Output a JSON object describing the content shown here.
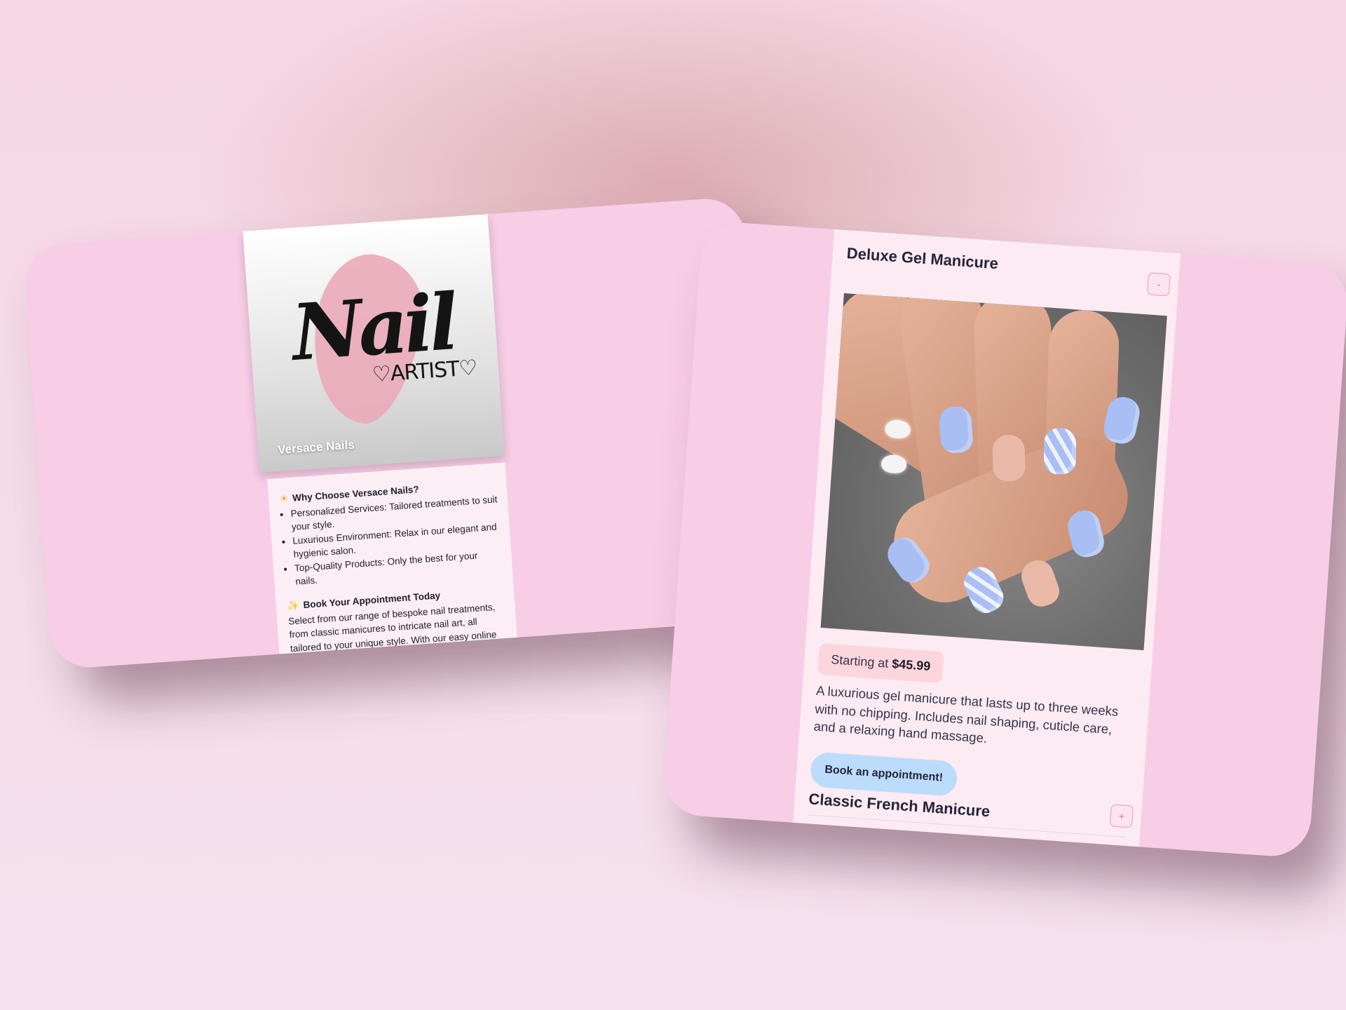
{
  "brand": {
    "logo_text_main": "Nail",
    "logo_text_sub": "♡ARTIST♡",
    "caption": "Versace Nails"
  },
  "info": {
    "why_heading": "Why Choose Versace Nails?",
    "benefits": [
      "Personalized Services: Tailored treatments to suit your style.",
      "Luxurious Environment: Relax in our elegant and hygienic salon.",
      "Top-Quality Products: Only the best for your nails."
    ],
    "book_heading": "Book Your Appointment Today",
    "book_text": "Select from our range of bespoke nail treatments, from classic manicures to intricate nail art, all tailored to your unique style. With our easy online booking system, securing your spot has never been simpler."
  },
  "services": [
    {
      "title": "Deluxe Gel Manicure",
      "toggle": "-",
      "price_prefix": "Starting at",
      "price": "$45.99",
      "description": "A luxurious gel manicure that lasts up to three weeks with no chipping. Includes nail shaping, cuticle care, and a relaxing hand massage.",
      "cta": "Book an appointment!"
    },
    {
      "title": "Classic French Manicure",
      "toggle": "+"
    }
  ],
  "colors": {
    "panel": "#f8cde6",
    "card": "#fceef5",
    "accent_blue": "#bcdcfc",
    "nail_blue": "#a9bff4"
  }
}
